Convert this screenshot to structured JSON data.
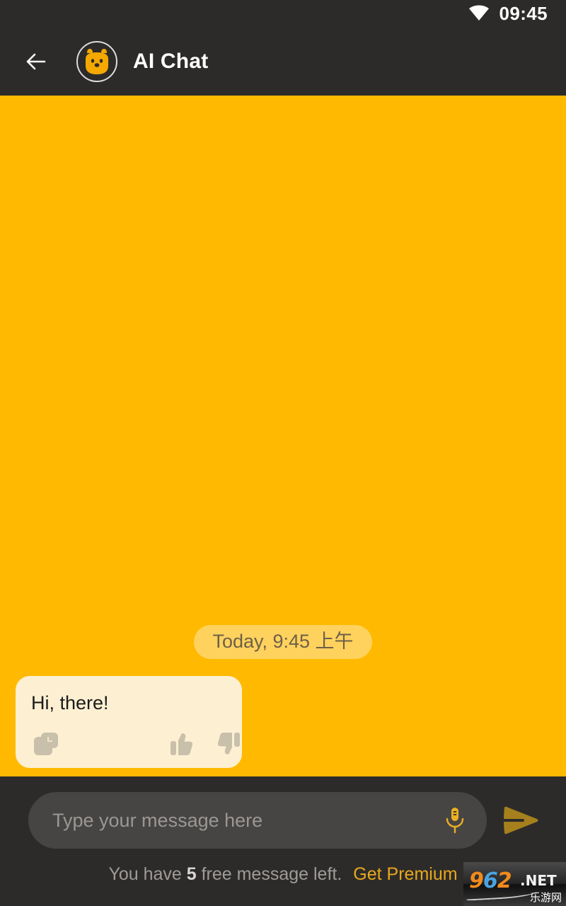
{
  "status_bar": {
    "time": "09:45",
    "wifi_icon": "wifi-icon"
  },
  "app_bar": {
    "back_icon": "back-arrow-icon",
    "avatar_icon": "bear-avatar-icon",
    "title": "AI Chat"
  },
  "chat": {
    "background_color": "#ffb900",
    "timestamp": "Today, 9:45 上午",
    "messages": [
      {
        "role": "assistant",
        "text": "Hi, there!",
        "bubble_color": "#fdf0d2",
        "actions": [
          {
            "name": "copy-icon",
            "label": "Copy"
          },
          {
            "name": "thumbs-up-icon",
            "label": "Like"
          },
          {
            "name": "thumbs-down-icon",
            "label": "Dislike"
          }
        ]
      }
    ]
  },
  "composer": {
    "placeholder": "Type your message here",
    "value": "",
    "mic_icon": "microphone-icon",
    "send_icon": "send-icon",
    "input_bg": "#474544"
  },
  "quota": {
    "prefix": "You have ",
    "count": "5",
    "suffix": " free message left.",
    "premium_label": "Get Premium",
    "premium_color": "#e8a81b"
  },
  "watermark": {
    "digit_9": "9",
    "digit_6": "6",
    "digit_2": "2",
    "net": ".NET",
    "cn": "乐游网"
  }
}
